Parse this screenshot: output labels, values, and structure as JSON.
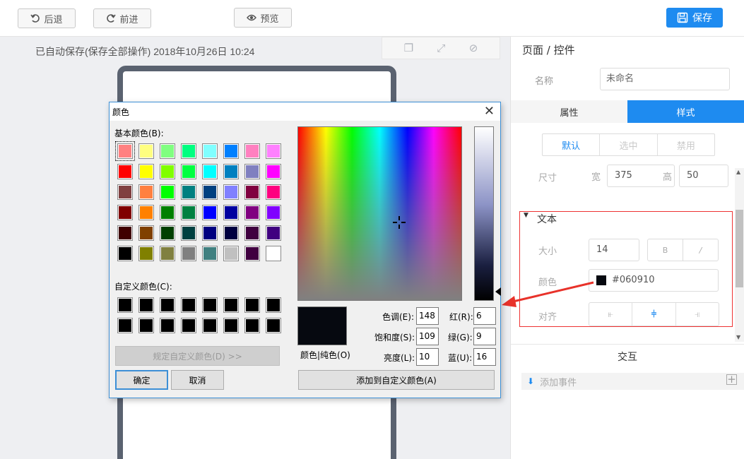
{
  "toolbar": {
    "back": "后退",
    "forward": "前进",
    "preview": "预览",
    "save": "保存"
  },
  "autosave": "已自动保存(保存全部操作) 2018年10月26日 10:24",
  "panel": {
    "breadcrumb": "页面 / 控件",
    "name_label": "名称",
    "name_value": "未命名",
    "tabs": [
      "属性",
      "样式"
    ],
    "states": [
      "默认",
      "选中",
      "禁用"
    ],
    "size_label": "尺寸",
    "width_label": "宽",
    "width": "375",
    "height_label": "高",
    "height": "50",
    "text_section": "文本",
    "font_size_label": "大小",
    "font_size": "14",
    "bold": "B",
    "italic": "/",
    "color_label": "颜色",
    "color_value": "#060910",
    "align_label": "对齐",
    "interaction": "交互",
    "add_event": "添加事件"
  },
  "dialog": {
    "title": "颜色",
    "basic_label": "基本颜色(B):",
    "custom_label": "自定义颜色(C):",
    "define_custom": "规定自定义颜色(D) >>",
    "ok": "确定",
    "cancel": "取消",
    "solid_label": "颜色|纯色(O)",
    "hue_label": "色调(E):",
    "hue": "148",
    "sat_label": "饱和度(S):",
    "sat": "109",
    "lum_label": "亮度(L):",
    "lum": "10",
    "red_label": "红(R):",
    "red": "6",
    "green_label": "绿(G):",
    "green": "9",
    "blue_label": "蓝(U):",
    "blue": "16",
    "add_custom": "添加到自定义颜色(A)",
    "basic_colors": [
      "#ff8080",
      "#ffff80",
      "#80ff80",
      "#00ff80",
      "#80ffff",
      "#0080ff",
      "#ff80c0",
      "#ff80ff",
      "#ff0000",
      "#ffff00",
      "#80ff00",
      "#00ff40",
      "#00ffff",
      "#0080c0",
      "#8080c0",
      "#ff00ff",
      "#804040",
      "#ff8040",
      "#00ff00",
      "#008080",
      "#004080",
      "#8080ff",
      "#800040",
      "#ff0080",
      "#800000",
      "#ff8000",
      "#008000",
      "#008040",
      "#0000ff",
      "#0000a0",
      "#800080",
      "#8000ff",
      "#400000",
      "#804000",
      "#004000",
      "#004040",
      "#000080",
      "#000040",
      "#400040",
      "#400080",
      "#000000",
      "#808000",
      "#808040",
      "#808080",
      "#408080",
      "#c0c0c0",
      "#400040",
      "#ffffff"
    ],
    "custom_colors": [
      "#000000",
      "#000000",
      "#000000",
      "#000000",
      "#000000",
      "#000000",
      "#000000",
      "#000000",
      "#000000",
      "#000000",
      "#000000",
      "#000000",
      "#000000",
      "#000000",
      "#000000",
      "#000000"
    ],
    "current_color": "#060910"
  }
}
